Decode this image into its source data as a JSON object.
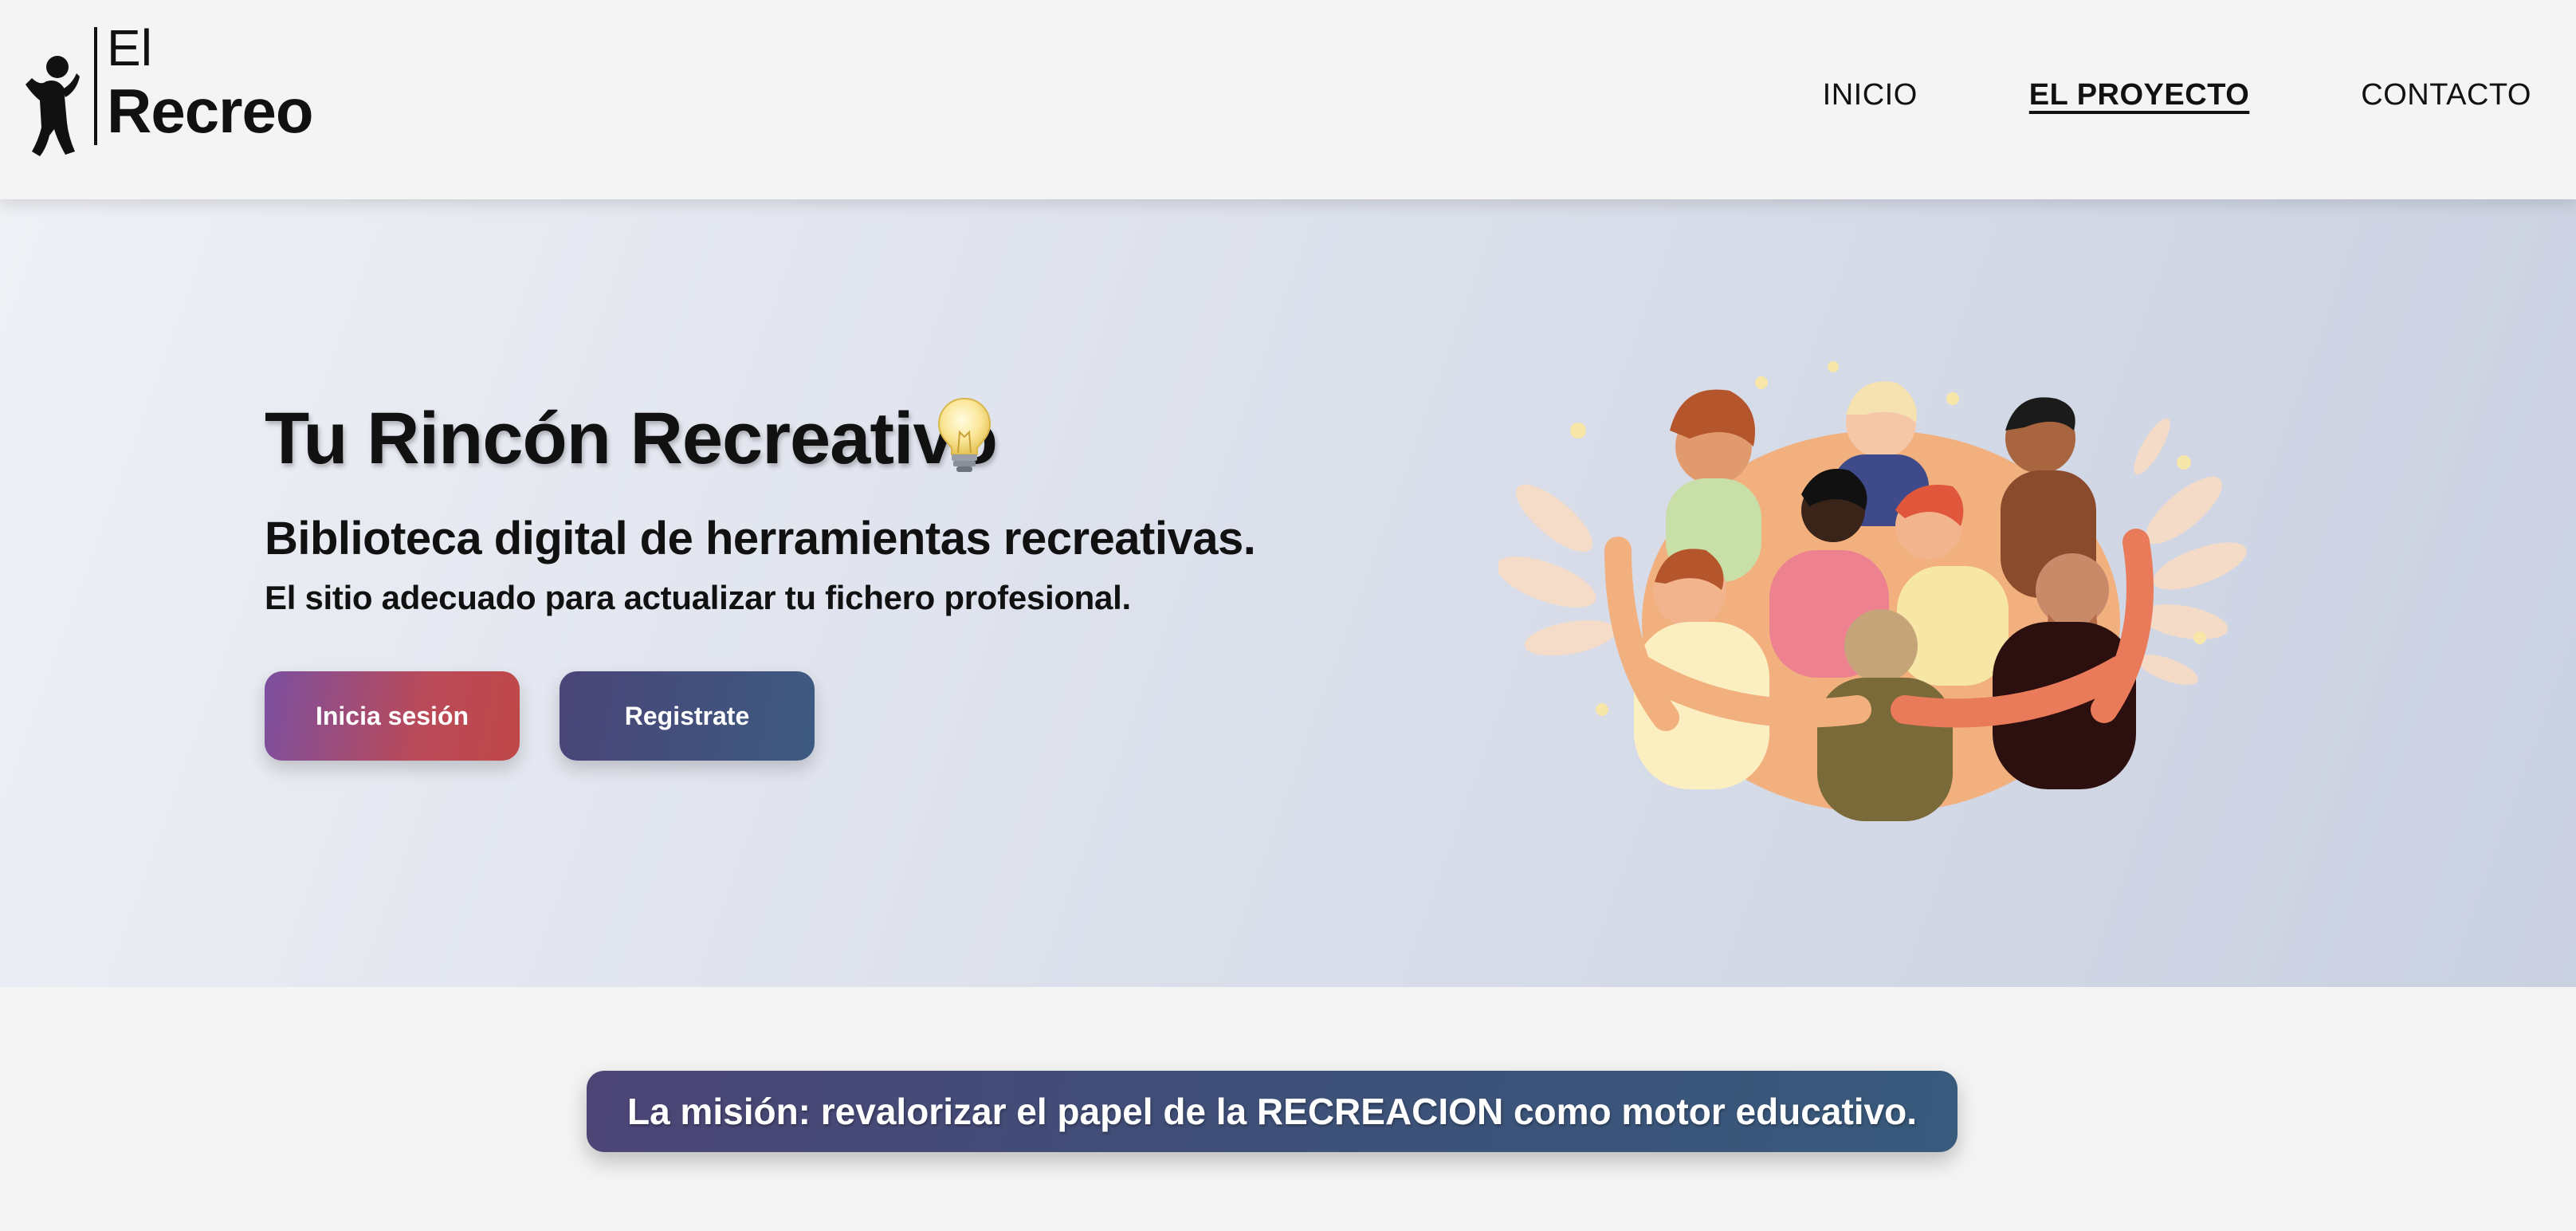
{
  "logo": {
    "line1": "El",
    "line2": "Recreo"
  },
  "nav": {
    "items": [
      {
        "label": "INICIO",
        "active": false
      },
      {
        "label": "EL PROYECTO",
        "active": true
      },
      {
        "label": "CONTACTO",
        "active": false
      }
    ]
  },
  "hero": {
    "title": "Tu Rincón Recreativo",
    "subtitle": "Biblioteca digital de herramientas recreativas.",
    "tagline": "El sitio adecuado para actualizar tu fichero profesional.",
    "login_label": "Inicia sesión",
    "register_label": "Registrate",
    "title_icon": "lightbulb-icon",
    "illustration": "group-hug-illustration"
  },
  "mission": {
    "text": "La misión: revalorizar el papel de la RECREACION como motor educativo."
  },
  "colors": {
    "login_gradient": [
      "#7b4fa0",
      "#c04848"
    ],
    "register_gradient": [
      "#4a4578",
      "#3d5a80"
    ],
    "mission_gradient": [
      "#4c4576",
      "#385a7c"
    ]
  }
}
